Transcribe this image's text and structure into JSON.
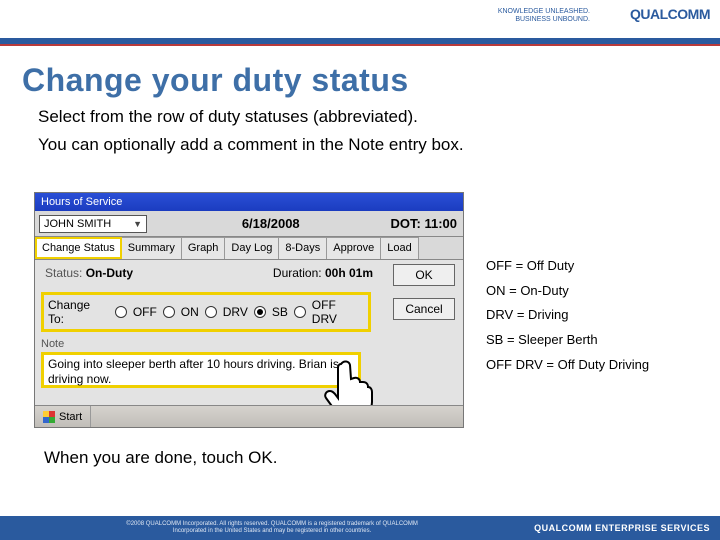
{
  "header": {
    "tagline1": "KNOWLEDGE UNLEASHED.",
    "tagline2": "BUSINESS UNBOUND.",
    "logo": "QUALCOMM"
  },
  "title": "Change your duty status",
  "body": {
    "line1": "Select from the row of duty statuses (abbreviated).",
    "line2": "You can optionally add a comment in the Note entry box."
  },
  "app": {
    "window_title": "Hours of Service",
    "driver_name": "JOHN SMITH",
    "date": "6/18/2008",
    "dot_clock": "DOT: 11:00",
    "tabs": [
      "Change Status",
      "Summary",
      "Graph",
      "Day Log",
      "8-Days",
      "Approve",
      "Load"
    ],
    "active_tab_index": 0,
    "status_label": "Status:",
    "status_value": "On-Duty",
    "duration_label": "Duration:",
    "duration_value": "00h 01m",
    "ok_label": "OK",
    "cancel_label": "Cancel",
    "change_label": "Change To:",
    "options": [
      "OFF",
      "ON",
      "DRV",
      "SB",
      "OFF DRV"
    ],
    "selected_option_index": 3,
    "note_label": "Note",
    "note_value": "Going into sleeper berth after 10 hours driving. Brian is driving now.",
    "start_label": "Start"
  },
  "legend": {
    "items": [
      "OFF = Off Duty",
      "ON = On-Duty",
      "DRV = Driving",
      "SB = Sleeper Berth",
      "OFF DRV = Off Duty Driving"
    ]
  },
  "closing": "When you are done, touch OK.",
  "footer": {
    "copyright": "©2008 QUALCOMM Incorporated. All rights reserved. QUALCOMM is a registered trademark of QUALCOMM Incorporated in the United States and may be registered in other countries.",
    "brand": "QUALCOMM ENTERPRISE SERVICES"
  }
}
